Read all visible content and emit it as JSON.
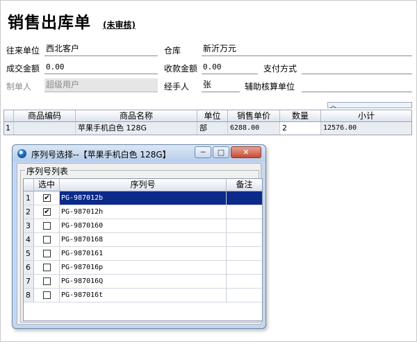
{
  "header": {
    "title": "销售出库单",
    "status": "(未审核)"
  },
  "form": {
    "partner_label": "往来单位",
    "partner_value": "西北客户",
    "warehouse_label": "仓库",
    "warehouse_value": "新沂万元",
    "amount_label": "成交金额",
    "amount_value": "0.00",
    "received_label": "收款金额",
    "received_value": "0.00",
    "payment_label": "支付方式",
    "payment_value": "",
    "creator_label": "制单人",
    "creator_value": "超级用户",
    "handler_label": "经手人",
    "handler_value": "张",
    "aux_unit_label": "辅助核算单位",
    "aux_unit_value": ""
  },
  "grid": {
    "columns": [
      "商品编码",
      "商品名称",
      "单位",
      "销售单价",
      "数量",
      "小计"
    ],
    "rows": [
      {
        "no": "1",
        "code": "",
        "name": "苹果手机白色 128G",
        "unit": "部",
        "price": "6288.00",
        "qty": "2",
        "subtotal": "12576.00"
      }
    ]
  },
  "dialog": {
    "title": "序列号选择--【苹果手机白色 128G】",
    "min_label": "─",
    "max_label": "□",
    "close_label": "✕",
    "group_label": "序列号列表",
    "columns": [
      "选中",
      "序列号",
      "备注"
    ],
    "rows": [
      {
        "no": "1",
        "checked": true,
        "serial": "PG-987012b",
        "note": ""
      },
      {
        "no": "2",
        "checked": true,
        "serial": "PG-987012h",
        "note": ""
      },
      {
        "no": "3",
        "checked": false,
        "serial": "PG-9870160",
        "note": ""
      },
      {
        "no": "4",
        "checked": false,
        "serial": "PG-9870168",
        "note": ""
      },
      {
        "no": "5",
        "checked": false,
        "serial": "PG-9870161",
        "note": ""
      },
      {
        "no": "6",
        "checked": false,
        "serial": "PG-987016p",
        "note": ""
      },
      {
        "no": "7",
        "checked": false,
        "serial": "PG-987016Q",
        "note": ""
      },
      {
        "no": "8",
        "checked": false,
        "serial": "PG-987016t",
        "note": ""
      }
    ],
    "selected_row": "1"
  },
  "colors": {
    "selection": "#0c2a8a",
    "dialog_frame": "#c4d7ee",
    "close_button": "#c74a33"
  }
}
